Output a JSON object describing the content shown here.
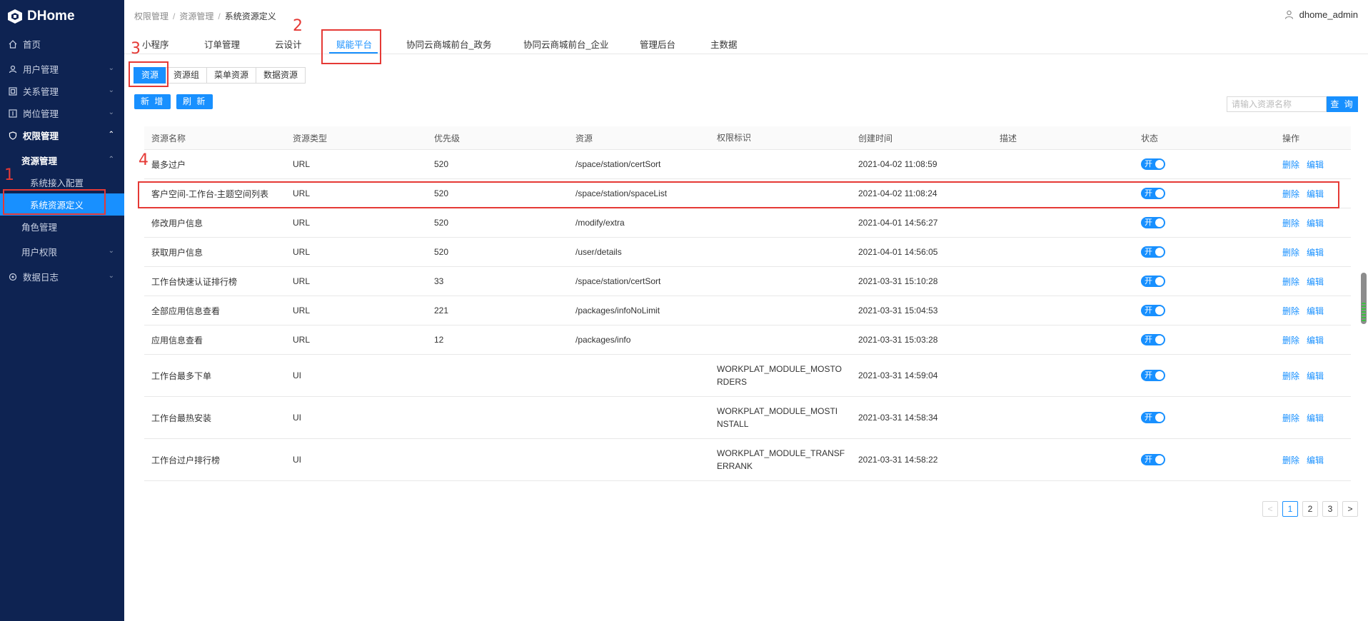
{
  "app": {
    "name": "DHome"
  },
  "sidebar": {
    "items": [
      {
        "label": "首页",
        "icon": "home-icon"
      },
      {
        "label": "用户管理",
        "icon": "user-icon"
      },
      {
        "label": "关系管理",
        "icon": "relation-icon"
      },
      {
        "label": "岗位管理",
        "icon": "post-icon"
      },
      {
        "label": "权限管理",
        "icon": "shield-icon"
      },
      {
        "label": "数据日志",
        "icon": "log-icon"
      }
    ],
    "sub_group": "资源管理",
    "sub_items": [
      "系统接入配置",
      "系统资源定义"
    ],
    "sub_other": [
      "角色管理",
      "用户权限"
    ]
  },
  "breadcrumb": [
    "权限管理",
    "资源管理",
    "系统资源定义"
  ],
  "user": {
    "name": "dhome_admin"
  },
  "tabs": [
    "小程序",
    "订单管理",
    "云设计",
    "赋能平台",
    "协同云商城前台_政务",
    "协同云商城前台_企业",
    "管理后台",
    "主数据"
  ],
  "active_tab": "赋能平台",
  "subtabs": [
    "资源",
    "资源组",
    "菜单资源",
    "数据资源"
  ],
  "buttons": {
    "add": "新 增",
    "refresh": "刷 新",
    "search": "查 询"
  },
  "search": {
    "placeholder": "请输入资源名称"
  },
  "table": {
    "headers": [
      "资源名称",
      "资源类型",
      "优先级",
      "资源",
      "权限标识",
      "创建时间",
      "描述",
      "状态",
      "操作"
    ],
    "rows": [
      {
        "name": "最多过户",
        "type": "URL",
        "priority": "520",
        "resource": "/space/station/certSort",
        "perm": "",
        "time": "2021-04-02 11:08:59",
        "desc": "",
        "status": "开"
      },
      {
        "name": "客户空间-工作台-主题空间列表",
        "type": "URL",
        "priority": "520",
        "resource": "/space/station/spaceList",
        "perm": "",
        "time": "2021-04-02 11:08:24",
        "desc": "",
        "status": "开"
      },
      {
        "name": "修改用户信息",
        "type": "URL",
        "priority": "520",
        "resource": "/modify/extra",
        "perm": "",
        "time": "2021-04-01 14:56:27",
        "desc": "",
        "status": "开"
      },
      {
        "name": "获取用户信息",
        "type": "URL",
        "priority": "520",
        "resource": "/user/details",
        "perm": "",
        "time": "2021-04-01 14:56:05",
        "desc": "",
        "status": "开"
      },
      {
        "name": "工作台快速认证排行榜",
        "type": "URL",
        "priority": "33",
        "resource": "/space/station/certSort",
        "perm": "",
        "time": "2021-03-31 15:10:28",
        "desc": "",
        "status": "开"
      },
      {
        "name": "全部应用信息查看",
        "type": "URL",
        "priority": "221",
        "resource": "/packages/infoNoLimit",
        "perm": "",
        "time": "2021-03-31 15:04:53",
        "desc": "",
        "status": "开"
      },
      {
        "name": "应用信息查看",
        "type": "URL",
        "priority": "12",
        "resource": "/packages/info",
        "perm": "",
        "time": "2021-03-31 15:03:28",
        "desc": "",
        "status": "开"
      },
      {
        "name": "工作台最多下单",
        "type": "UI",
        "priority": "",
        "resource": "",
        "perm": "WORKPLAT_MODULE_MOSTORDERS",
        "perm_lines": [
          "WORKPLAT_MODULE_MOSTO",
          "RDERS"
        ],
        "time": "2021-03-31 14:59:04",
        "desc": "",
        "status": "开"
      },
      {
        "name": "工作台最热安装",
        "type": "UI",
        "priority": "",
        "resource": "",
        "perm": "WORKPLAT_MODULE_MOSTINSTALL",
        "perm_lines": [
          "WORKPLAT_MODULE_MOSTI",
          "NSTALL"
        ],
        "time": "2021-03-31 14:58:34",
        "desc": "",
        "status": "开"
      },
      {
        "name": "工作台过户排行榜",
        "type": "UI",
        "priority": "",
        "resource": "",
        "perm": "WORKPLAT_MODULE_TRANSFERRANK",
        "perm_lines": [
          "WORKPLAT_MODULE_TRANSF",
          "ERRANK"
        ],
        "time": "2021-03-31 14:58:22",
        "desc": "",
        "status": "开"
      }
    ],
    "ops": {
      "delete": "删除",
      "edit": "编辑"
    }
  },
  "pagination": {
    "pages": [
      "1",
      "2",
      "3"
    ],
    "current": "1",
    "prev": "<",
    "next": ">"
  },
  "annotations": [
    "1",
    "2",
    "3",
    "4"
  ],
  "colors": {
    "sidebar_bg": "#0e2352",
    "accent": "#1890ff",
    "annotation": "#e53935"
  }
}
